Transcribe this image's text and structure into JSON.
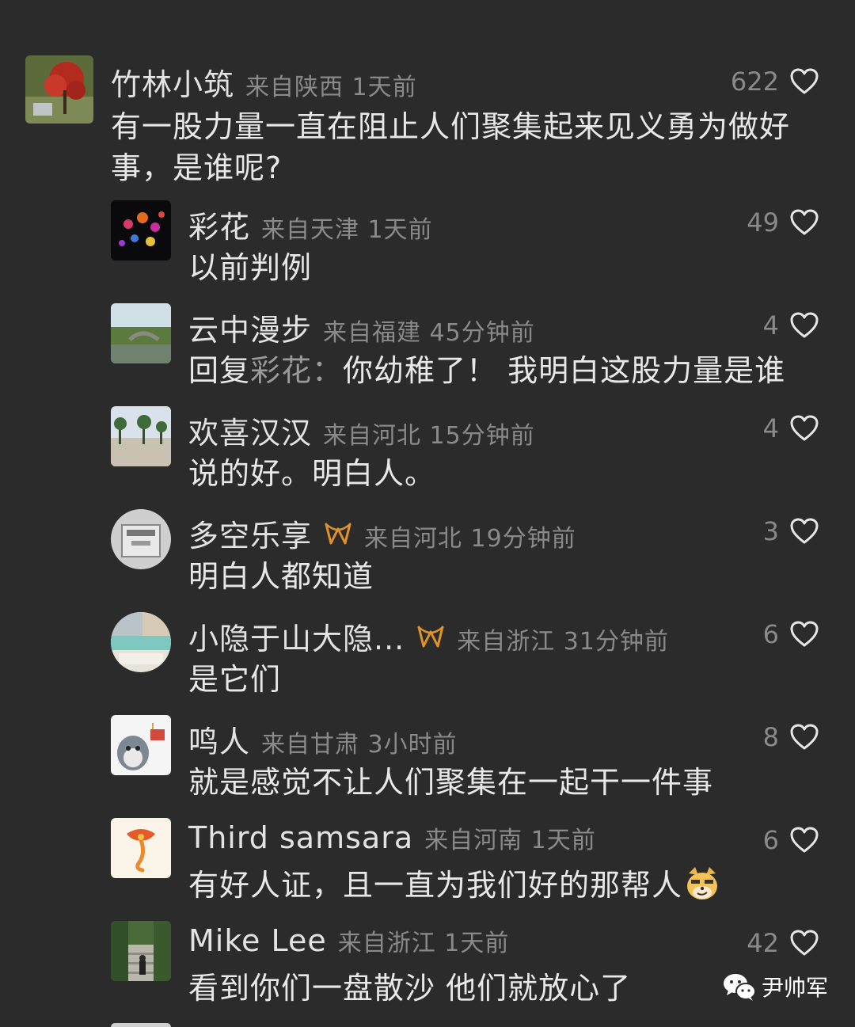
{
  "comments": [
    {
      "username": "竹林小筑",
      "meta": "来自陕西 1天前",
      "likes": "622",
      "text": "有一股力量一直在阻止人们聚集起来见义勇为做好事，是谁呢?"
    },
    {
      "username": "彩花",
      "meta": "来自天津 1天前",
      "likes": "49",
      "text": "以前判例"
    },
    {
      "username": "云中漫步",
      "meta": "来自福建 45分钟前",
      "likes": "4",
      "reply_prefix": "回复",
      "reply_target": "彩花：",
      "text": "你幼稚了！ 我明白这股力量是谁"
    },
    {
      "username": "欢喜汉汉",
      "meta": "来自河北 15分钟前",
      "likes": "4",
      "text": "说的好。明白人。"
    },
    {
      "username": "多空乐享",
      "meta": "来自河北 19分钟前",
      "likes": "3",
      "text": "明白人都知道"
    },
    {
      "username": "小隐于山大隐...",
      "meta": "来自浙江 31分钟前",
      "likes": "6",
      "text": "是它们"
    },
    {
      "username": "鸣人",
      "meta": "来自甘肃 3小时前",
      "likes": "8",
      "text": "就是感觉不让人们聚集在一起干一件事"
    },
    {
      "username": "Third samsara",
      "meta": "来自河南 1天前",
      "likes": "6",
      "text": "有好人证，且一直为我们好的那帮人"
    },
    {
      "username": "Mike Lee",
      "meta": "来自浙江 1天前",
      "likes": "42",
      "text": "看到你们一盘散沙 他们就放心了"
    }
  ],
  "watermark": {
    "text": "尹帅军"
  },
  "colors": {
    "background": "#2b2b2c",
    "username": "#e3e3e3",
    "meta": "#8a8a8a",
    "badge": "#e0922a"
  }
}
